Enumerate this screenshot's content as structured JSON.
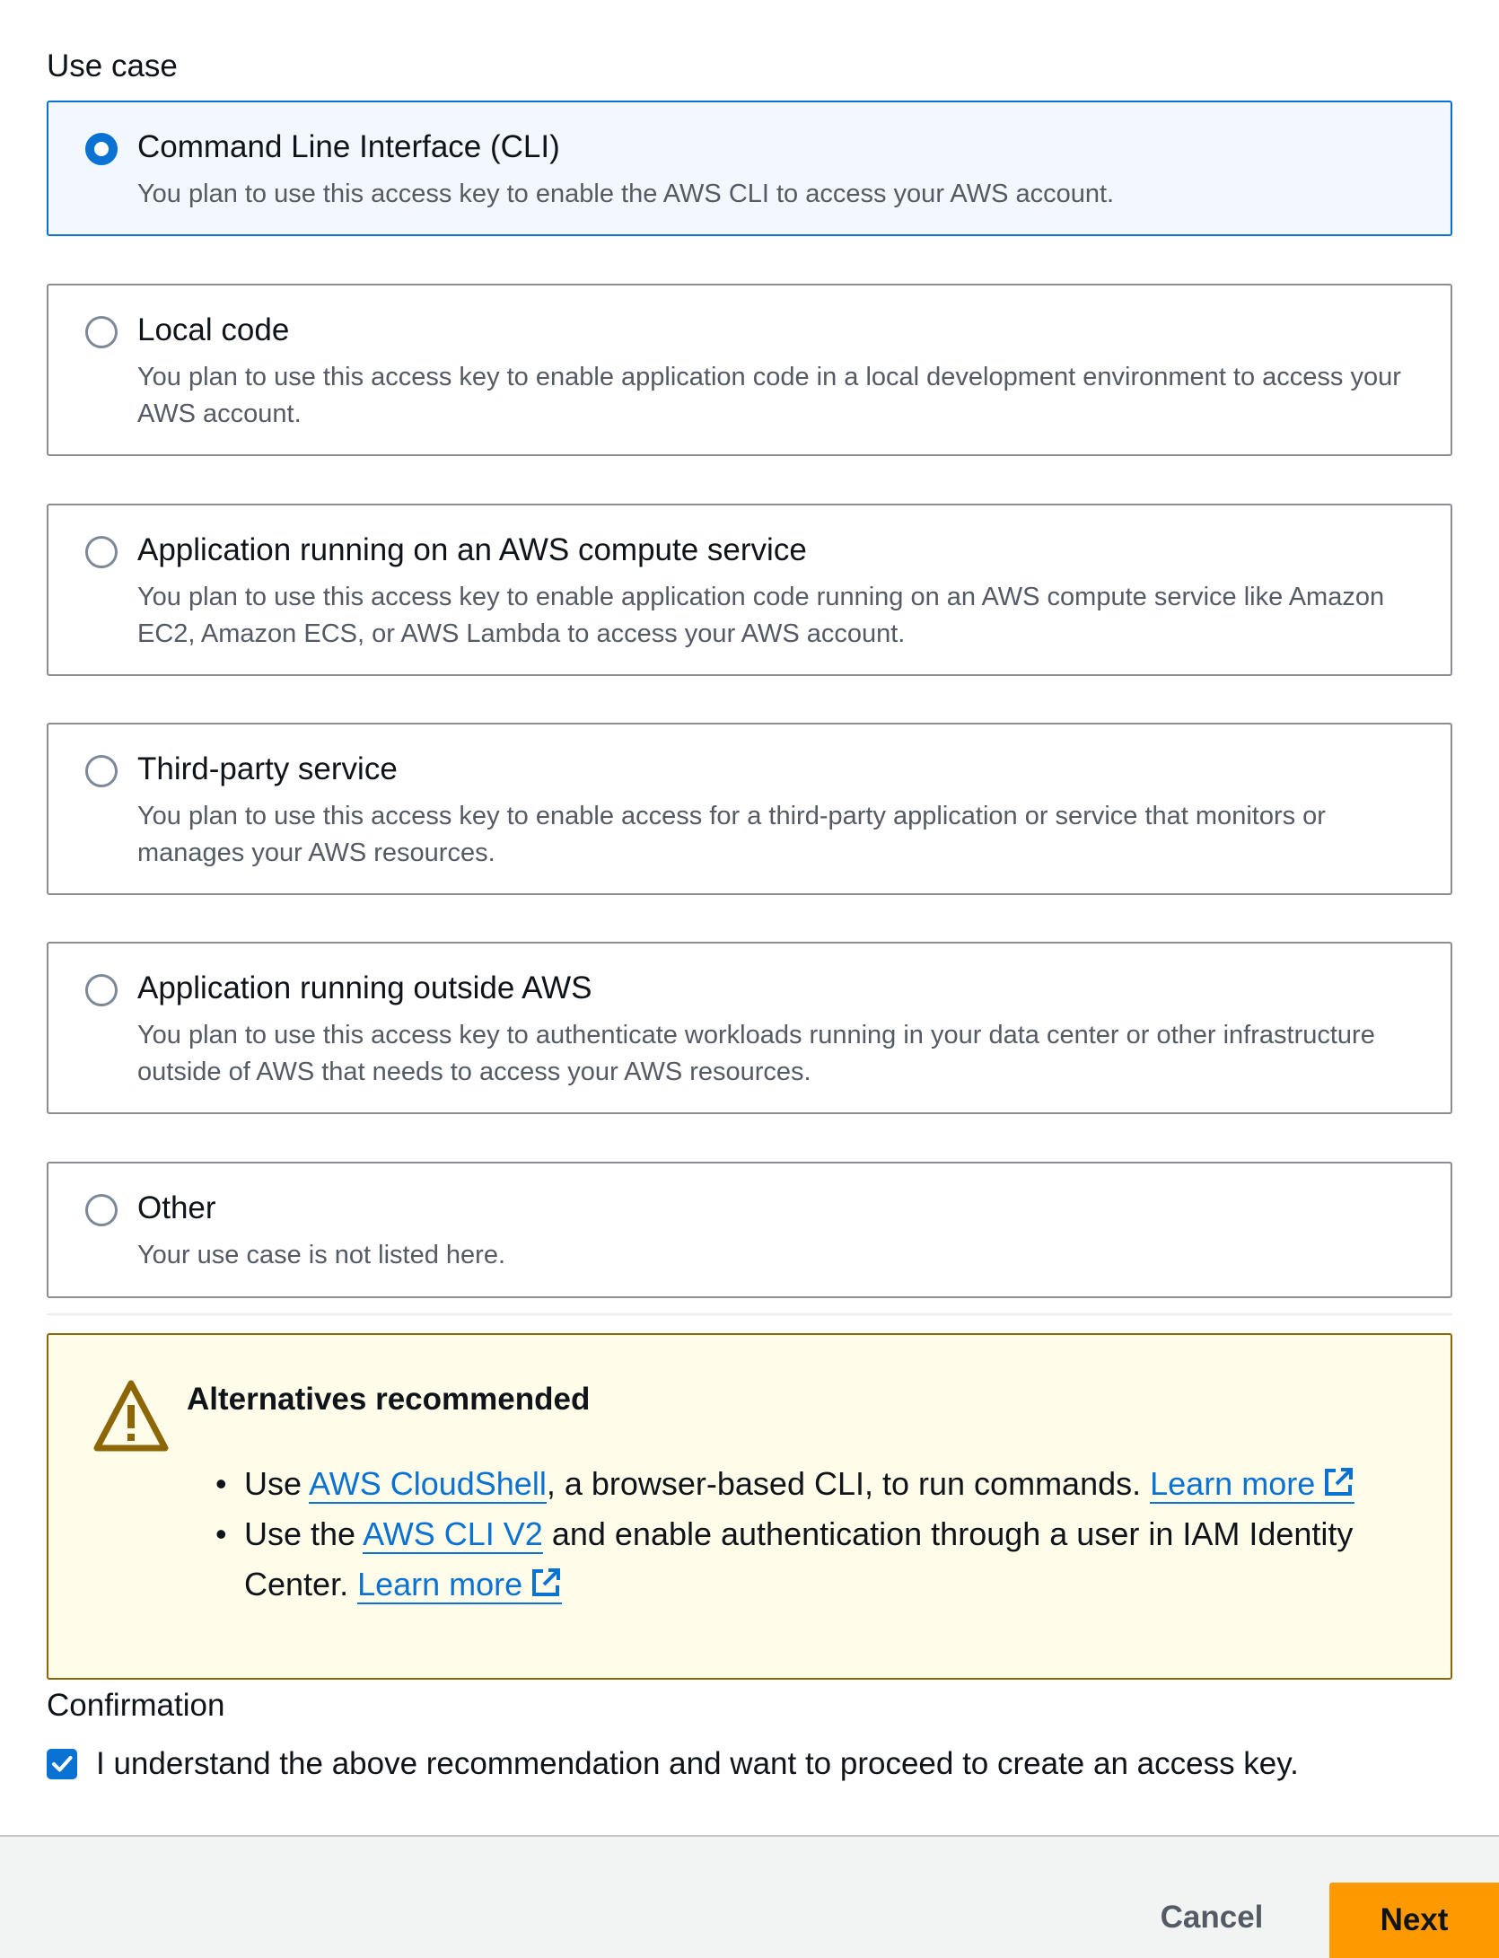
{
  "use_case": {
    "label": "Use case",
    "options": [
      {
        "title": "Command Line Interface (CLI)",
        "description": "You plan to use this access key to enable the AWS CLI to access your AWS account.",
        "selected": true
      },
      {
        "title": "Local code",
        "description": "You plan to use this access key to enable application code in a local development environment to access your AWS account.",
        "selected": false
      },
      {
        "title": "Application running on an AWS compute service",
        "description": "You plan to use this access key to enable application code running on an AWS compute service like Amazon EC2, Amazon ECS, or AWS Lambda to access your AWS account.",
        "selected": false
      },
      {
        "title": "Third-party service",
        "description": "You plan to use this access key to enable access for a third-party application or service that monitors or manages your AWS resources.",
        "selected": false
      },
      {
        "title": "Application running outside AWS",
        "description": "You plan to use this access key to authenticate workloads running in your data center or other infrastructure outside of AWS that needs to access your AWS resources.",
        "selected": false
      },
      {
        "title": "Other",
        "description": "Your use case is not listed here.",
        "selected": false
      }
    ]
  },
  "alert": {
    "icon": "warning-icon",
    "title": "Alternatives recommended",
    "items": [
      {
        "prefix": "Use ",
        "link": "AWS CloudShell",
        "middle": ", a browser-based CLI, to run commands. ",
        "learn_more": "Learn more"
      },
      {
        "prefix": "Use the ",
        "link": "AWS CLI V2",
        "middle": " and enable authentication through a user in IAM Identity Center. ",
        "learn_more": "Learn more"
      }
    ],
    "colors": {
      "background": "#fffce9",
      "border": "#8d6605",
      "icon": "#8d6605"
    }
  },
  "confirmation": {
    "label": "Confirmation",
    "checkbox_text": "I understand the above recommendation and want to proceed to create an access key.",
    "checked": true
  },
  "footer": {
    "cancel_label": "Cancel",
    "next_label": "Next"
  },
  "colors": {
    "accent": "#0972d3",
    "primary_button": "#ff9900"
  }
}
